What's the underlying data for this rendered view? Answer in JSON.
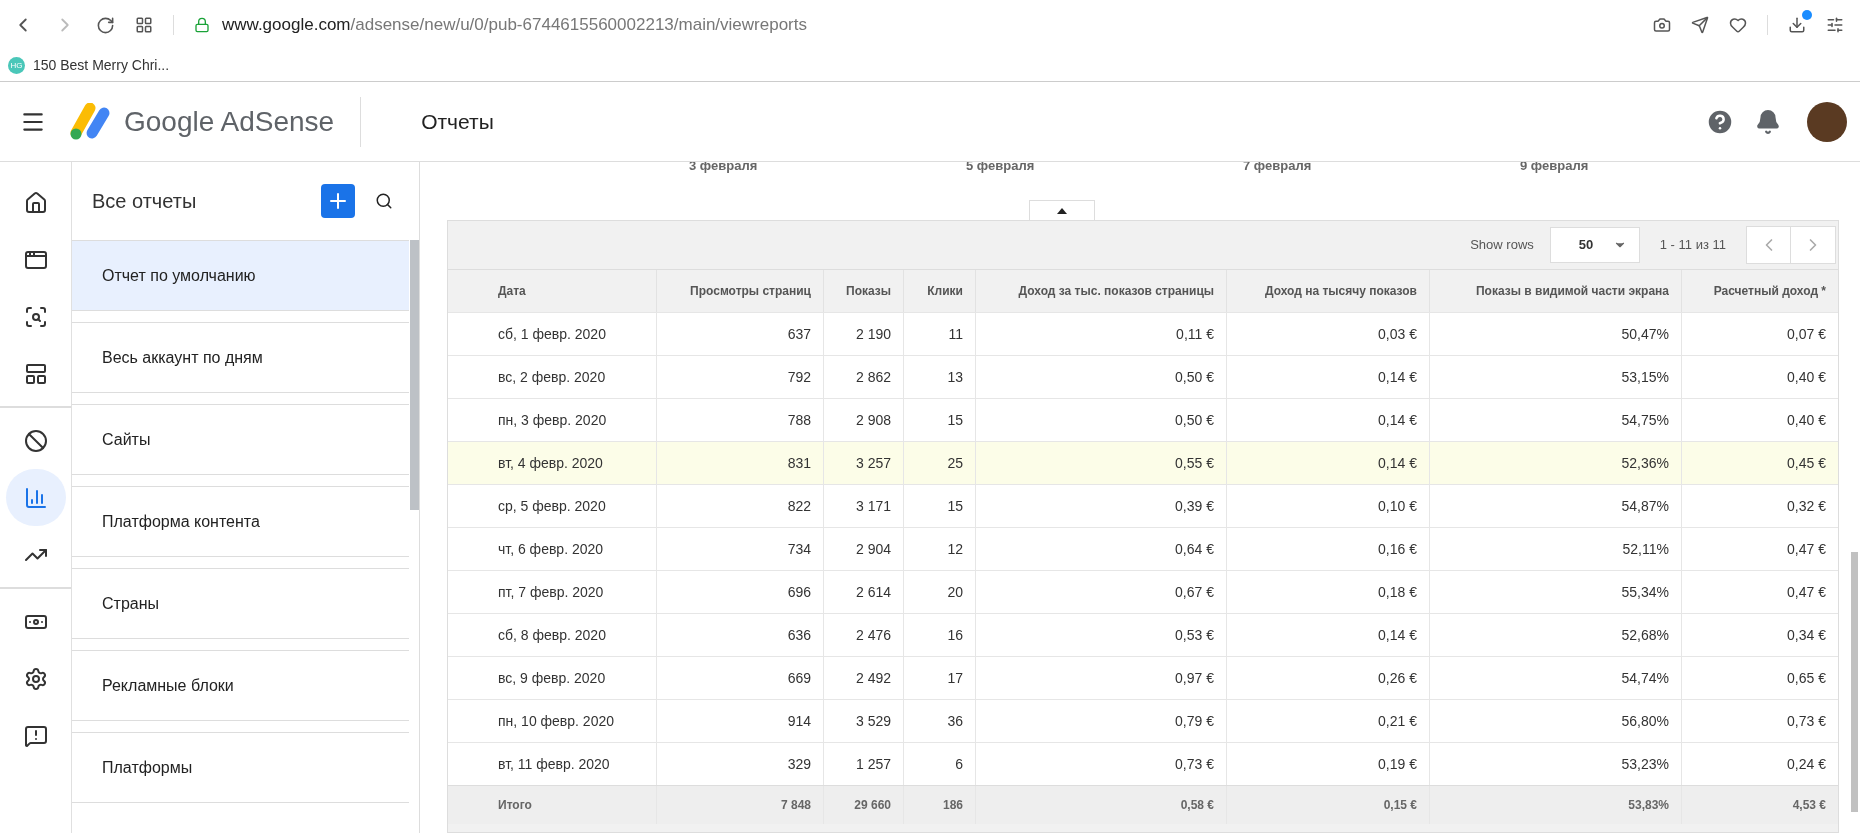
{
  "browser": {
    "url_host": "www.google.com",
    "url_path": "/adsense/new/u/0/pub-6744615560002213/main/viewreports",
    "download_badge": true,
    "bookmarks": [
      {
        "favicon": "HG",
        "label": "150 Best Merry Chri..."
      }
    ]
  },
  "app": {
    "product": "Google AdSense",
    "page_title": "Отчеты"
  },
  "rail": {
    "groups": [
      [
        {
          "selected": false
        },
        {
          "selected": false
        },
        {
          "selected": false
        },
        {
          "selected": false
        }
      ],
      [
        {
          "selected": false
        },
        {
          "selected": true
        },
        {
          "selected": false
        }
      ],
      [
        {
          "selected": false
        },
        {
          "selected": false
        },
        {
          "selected": false
        }
      ]
    ]
  },
  "reports_panel": {
    "title": "Все отчеты",
    "items": [
      {
        "label": "Отчет по умолчанию",
        "selected": true
      },
      {
        "label": "Весь аккаунт по дням",
        "selected": false
      },
      {
        "label": "Сайты",
        "selected": false
      },
      {
        "label": "Платформа контента",
        "selected": false
      },
      {
        "label": "Страны",
        "selected": false
      },
      {
        "label": "Рекламные блоки",
        "selected": false
      },
      {
        "label": "Платформы",
        "selected": false
      }
    ]
  },
  "chart_axis_labels": [
    "3 февраля",
    "5 февраля",
    "7 февраля",
    "9 февраля"
  ],
  "table": {
    "show_rows_label": "Show rows",
    "rows_per_page": "50",
    "range": "1 - 11 из 11",
    "columns": [
      "Дата",
      "Просмотры страниц",
      "Показы",
      "Клики",
      "Доход за тыс. показов страницы",
      "Доход на тысячу показов",
      "Показы в видимой части экрана",
      "Расчетный доход *"
    ],
    "rows": [
      {
        "highlighted": false,
        "cells": [
          "сб, 1 февр. 2020",
          "637",
          "2 190",
          "11",
          "0,11 €",
          "0,03 €",
          "50,47%",
          "0,07 €"
        ]
      },
      {
        "highlighted": false,
        "cells": [
          "вс, 2 февр. 2020",
          "792",
          "2 862",
          "13",
          "0,50 €",
          "0,14 €",
          "53,15%",
          "0,40 €"
        ]
      },
      {
        "highlighted": false,
        "cells": [
          "пн, 3 февр. 2020",
          "788",
          "2 908",
          "15",
          "0,50 €",
          "0,14 €",
          "54,75%",
          "0,40 €"
        ]
      },
      {
        "highlighted": true,
        "cells": [
          "вт, 4 февр. 2020",
          "831",
          "3 257",
          "25",
          "0,55 €",
          "0,14 €",
          "52,36%",
          "0,45 €"
        ]
      },
      {
        "highlighted": false,
        "cells": [
          "ср, 5 февр. 2020",
          "822",
          "3 171",
          "15",
          "0,39 €",
          "0,10 €",
          "54,87%",
          "0,32 €"
        ]
      },
      {
        "highlighted": false,
        "cells": [
          "чт, 6 февр. 2020",
          "734",
          "2 904",
          "12",
          "0,64 €",
          "0,16 €",
          "52,11%",
          "0,47 €"
        ]
      },
      {
        "highlighted": false,
        "cells": [
          "пт, 7 февр. 2020",
          "696",
          "2 614",
          "20",
          "0,67 €",
          "0,18 €",
          "55,34%",
          "0,47 €"
        ]
      },
      {
        "highlighted": false,
        "cells": [
          "сб, 8 февр. 2020",
          "636",
          "2 476",
          "16",
          "0,53 €",
          "0,14 €",
          "52,68%",
          "0,34 €"
        ]
      },
      {
        "highlighted": false,
        "cells": [
          "вс, 9 февр. 2020",
          "669",
          "2 492",
          "17",
          "0,97 €",
          "0,26 €",
          "54,74%",
          "0,65 €"
        ]
      },
      {
        "highlighted": false,
        "cells": [
          "пн, 10 февр. 2020",
          "914",
          "3 529",
          "36",
          "0,79 €",
          "0,21 €",
          "56,80%",
          "0,73 €"
        ]
      },
      {
        "highlighted": false,
        "cells": [
          "вт, 11 февр. 2020",
          "329",
          "1 257",
          "6",
          "0,73 €",
          "0,19 €",
          "53,23%",
          "0,24 €"
        ]
      }
    ],
    "totals": [
      "Итого",
      "7 848",
      "29 660",
      "186",
      "0,58 €",
      "0,15 €",
      "53,83%",
      "4,53 €"
    ]
  }
}
